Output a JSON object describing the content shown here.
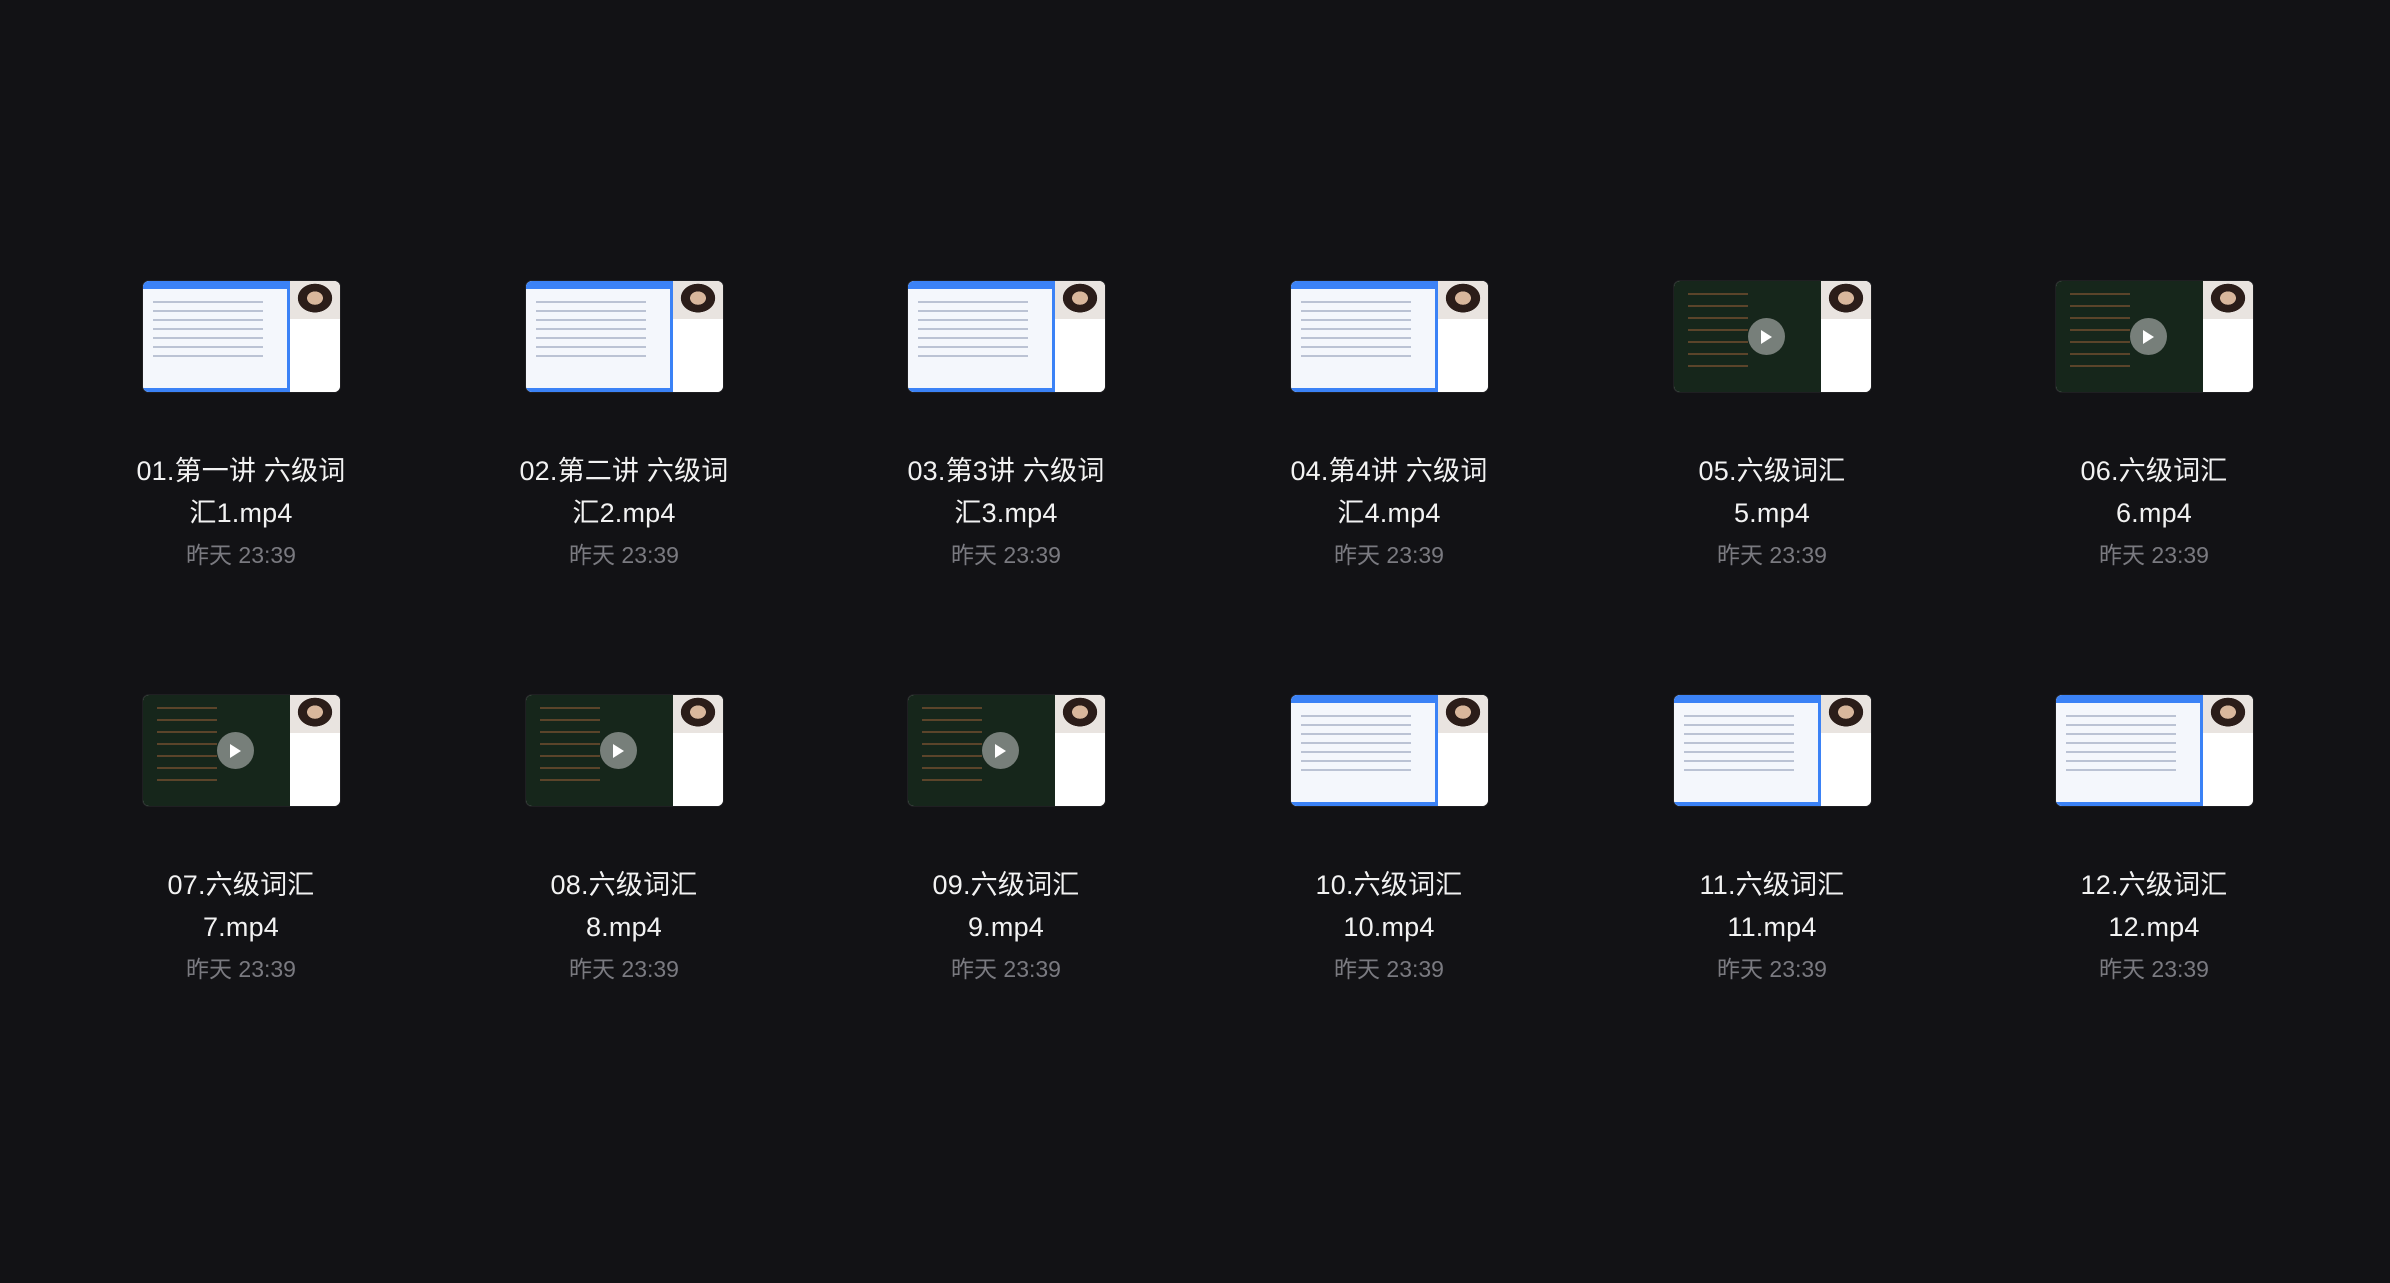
{
  "files": [
    {
      "name": "01.第一讲 六级词\n汇1.mp4",
      "date": "昨天 23:39",
      "style": "light",
      "play": false
    },
    {
      "name": "02.第二讲 六级词\n汇2.mp4",
      "date": "昨天 23:39",
      "style": "light",
      "play": false
    },
    {
      "name": "03.第3讲 六级词\n汇3.mp4",
      "date": "昨天 23:39",
      "style": "light",
      "play": false
    },
    {
      "name": "04.第4讲 六级词\n汇4.mp4",
      "date": "昨天 23:39",
      "style": "light",
      "play": false
    },
    {
      "name": "05.六级词汇\n5.mp4",
      "date": "昨天 23:39",
      "style": "dark",
      "play": true
    },
    {
      "name": "06.六级词汇\n6.mp4",
      "date": "昨天 23:39",
      "style": "dark",
      "play": true
    },
    {
      "name": "07.六级词汇\n7.mp4",
      "date": "昨天 23:39",
      "style": "dark",
      "play": true
    },
    {
      "name": "08.六级词汇\n8.mp4",
      "date": "昨天 23:39",
      "style": "dark",
      "play": true
    },
    {
      "name": "09.六级词汇\n9.mp4",
      "date": "昨天 23:39",
      "style": "dark",
      "play": true
    },
    {
      "name": "10.六级词汇\n10.mp4",
      "date": "昨天 23:39",
      "style": "light",
      "play": false
    },
    {
      "name": "11.六级词汇\n11.mp4",
      "date": "昨天 23:39",
      "style": "light",
      "play": false
    },
    {
      "name": "12.六级词汇\n12.mp4",
      "date": "昨天 23:39",
      "style": "light",
      "play": false
    }
  ],
  "icons": {
    "play": "play-icon"
  },
  "colors": {
    "background": "#121215",
    "title": "#f2f2f2",
    "date": "#7a7a80",
    "accent": "#3b82f6"
  }
}
